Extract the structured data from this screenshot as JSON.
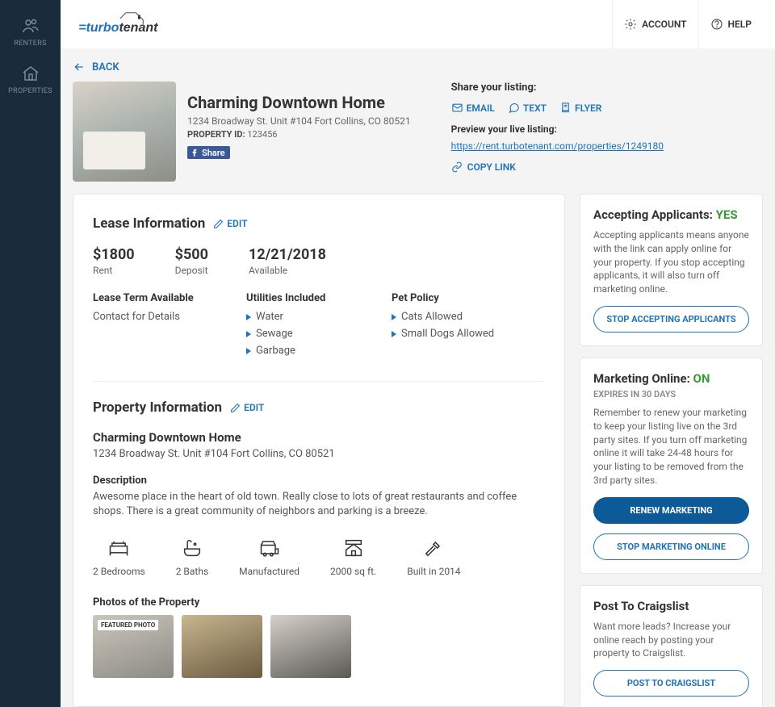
{
  "sidebar": {
    "renters": "RENTERS",
    "properties": "PROPERTIES"
  },
  "header": {
    "account": "ACCOUNT",
    "help": "HELP"
  },
  "back": "BACK",
  "property": {
    "title": "Charming Downtown Home",
    "address": "1234 Broadway St. Unit #104 Fort Collins, CO 80521",
    "pid_label": "PROPERTY ID:",
    "pid": "123456",
    "fb_share": "Share"
  },
  "share": {
    "heading": "Share your listing:",
    "email": "EMAIL",
    "text": "TEXT",
    "flyer": "FLYER",
    "preview_label": "Preview your live listing:",
    "url": "https://rent.turbotenant.com/properties/1249180",
    "copy": "COPY LINK"
  },
  "lease": {
    "title": "Lease Information",
    "edit": "EDIT",
    "rent": "$1800",
    "rent_label": "Rent",
    "deposit": "$500",
    "deposit_label": "Deposit",
    "available": "12/21/2018",
    "available_label": "Available",
    "term_h": "Lease Term Available",
    "term_v": "Contact for Details",
    "util_h": "Utilities Included",
    "util1": "Water",
    "util2": "Sewage",
    "util3": "Garbage",
    "pet_h": "Pet Policy",
    "pet1": "Cats Allowed",
    "pet2": "Small Dogs Allowed"
  },
  "pinfo": {
    "title": "Property Information",
    "edit": "EDIT",
    "name": "Charming Downtown Home",
    "addr": "1234 Broadway St. Unit #104 Fort Collins, CO 80521",
    "desc_h": "Description",
    "desc": "Awesome place in the heart of old town. Really close to lots of great restaurants and coffee shops. There is a great community of neighbors and parking is a breeze.",
    "beds": "2 Bedrooms",
    "baths": "2 Baths",
    "type": "Manufactured",
    "sqft": "2000 sq ft.",
    "built": "Built in 2014",
    "photos_h": "Photos of the Property",
    "featured": "FEATURED PHOTO"
  },
  "accept": {
    "title": "Accepting Applicants: ",
    "status": "YES",
    "text": "Accepting applicants means anyone with the link can apply online for your property. If you stop accepting applicants, it will also turn off marketing online.",
    "btn": "STOP ACCEPTING APPLICANTS"
  },
  "marketing": {
    "title": "Marketing Online: ",
    "status": "ON",
    "expires": "EXPIRES IN 30 DAYS",
    "text": "Remember to renew your marketing to keep your listing live on the 3rd party sites. If you turn off marketing online it will take 24-48 hours for your listing to be removed from the 3rd party sites.",
    "renew": "RENEW MARKETING",
    "stop": "STOP MARKETING ONLINE"
  },
  "craigslist": {
    "title": "Post To Craigslist",
    "text": "Want more leads? Increase your online reach by posting your property to Craigslist.",
    "btn": "POST TO CRAIGSLIST"
  }
}
